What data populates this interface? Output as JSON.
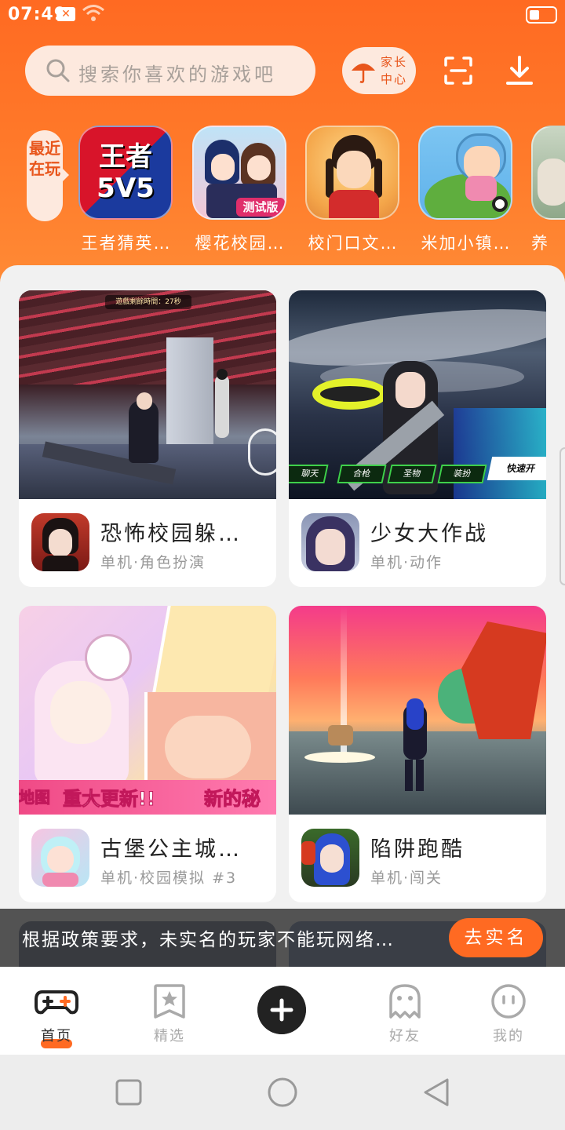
{
  "status_bar": {
    "time": "07:49",
    "x_badge": "✕"
  },
  "search": {
    "placeholder": "搜索你喜欢的游戏吧"
  },
  "parent_center": {
    "label": "家长\n中心"
  },
  "recent": {
    "tag": "最近在玩",
    "items": [
      {
        "name": "王者猜英…",
        "icon_text": "王者\n5V5"
      },
      {
        "name": "樱花校园…",
        "icon_text": "测试版"
      },
      {
        "name": "校门口文…"
      },
      {
        "name": "米加小镇…"
      },
      {
        "name": "养"
      }
    ]
  },
  "feed": [
    {
      "title": "恐怖校园躲…",
      "meta": "单机·角色扮演",
      "shot_text": "遊戲剩餘時間：27秒"
    },
    {
      "title": "少女大作战",
      "meta": "单机·动作",
      "buttons": [
        "合枪",
        "圣物",
        "装扮",
        "快速开"
      ],
      "left_fragment": "聊天"
    },
    {
      "title": "古堡公主城…",
      "meta": "单机·校园模拟 #3",
      "banner_pre": "地图",
      "banner": "重大更新!!",
      "banner_post": "新的秘"
    },
    {
      "title": "陷阱跑酷",
      "meta": "单机·闯关"
    }
  ],
  "notice": {
    "text": "根据政策要求，未实名的玩家不能玩网络…",
    "button": "去实名"
  },
  "tabbar": {
    "items": [
      {
        "label": "首页",
        "icon": "gamepad-icon",
        "active": true
      },
      {
        "label": "精选",
        "icon": "star-bookmark-icon"
      },
      {
        "label": "",
        "icon": "plus-icon"
      },
      {
        "label": "好友",
        "icon": "ghost-icon"
      },
      {
        "label": "我的",
        "icon": "face-icon"
      }
    ]
  },
  "colors": {
    "brand": "#ff6a22",
    "accent_bg": "#fde9de",
    "notice_btn": "#ff6a22"
  }
}
